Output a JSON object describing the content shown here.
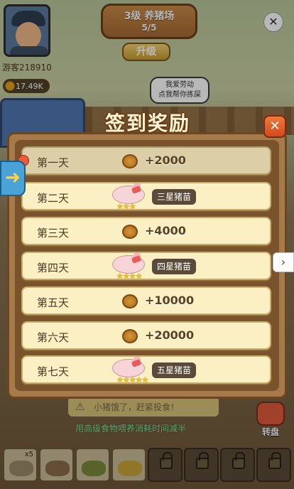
{
  "game": {
    "farm_title": "3级 养猪场",
    "farm_progress": "5/5",
    "upgrade_label": "升级",
    "speech": [
      "我爱劳动",
      "点我帮你拣屎"
    ],
    "player_name": "游客218910",
    "coins": "17.49K",
    "close_symbol": "✕"
  },
  "modal": {
    "title": "签到奖励",
    "close_symbol": "✕",
    "days": [
      {
        "label": "第一天",
        "type": "coin",
        "amount": "+2000",
        "claimed": true
      },
      {
        "label": "第二天",
        "type": "piglet",
        "stars": "★★★",
        "badge": "三星猪苗"
      },
      {
        "label": "第三天",
        "type": "coin",
        "amount": "+4000"
      },
      {
        "label": "第四天",
        "type": "piglet",
        "stars": "★★★★",
        "badge": "四星猪苗"
      },
      {
        "label": "第五天",
        "type": "coin",
        "amount": "+10000"
      },
      {
        "label": "第六天",
        "type": "coin",
        "amount": "+20000"
      },
      {
        "label": "第七天",
        "type": "piglet",
        "stars": "★★★★★",
        "badge": "五星猪苗"
      }
    ]
  },
  "bottom": {
    "notice": "小猪饿了，赶紧投食！",
    "hint": "用高级食物喂养消耗时间减半",
    "side_button": "转盘",
    "inventory": [
      {
        "count": "x5",
        "color": "#9a8a6a",
        "locked": false
      },
      {
        "count": "",
        "color": "#8b6a4a",
        "locked": false
      },
      {
        "count": "",
        "color": "#7a8a3a",
        "locked": false
      },
      {
        "count": "",
        "color": "#c9a23a",
        "locked": false
      },
      {
        "count": "",
        "color": "",
        "locked": true
      },
      {
        "count": "",
        "color": "",
        "locked": true
      },
      {
        "count": "",
        "color": "",
        "locked": true
      },
      {
        "count": "",
        "color": "",
        "locked": true
      }
    ]
  },
  "nav": {
    "left_arrow": "➜",
    "right_arrow": "›"
  }
}
